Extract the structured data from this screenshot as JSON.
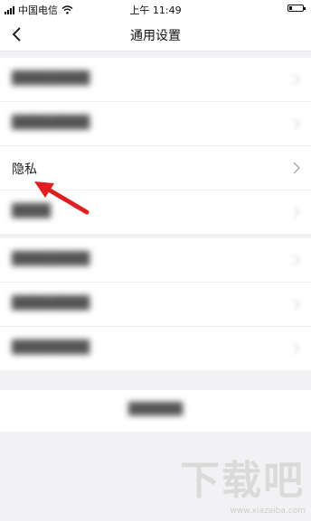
{
  "status_bar": {
    "carrier": "中国电信",
    "time": "上午 11:49",
    "wifi_icon": "wifi-icon",
    "battery_icon": "battery-icon"
  },
  "nav": {
    "back_icon": "chevron-left-icon",
    "title": "通用设置"
  },
  "settings_groups": [
    {
      "items": [
        {
          "label": "████████",
          "blurred": true
        },
        {
          "label": "████████",
          "blurred": true
        },
        {
          "label": "隐私",
          "blurred": false
        },
        {
          "label": "████",
          "blurred": true
        }
      ]
    },
    {
      "items": [
        {
          "label": "████████",
          "blurred": true
        },
        {
          "label": "████████",
          "blurred": true
        },
        {
          "label": "████████",
          "blurred": true
        }
      ]
    }
  ],
  "logout": {
    "label": "██████"
  },
  "annotation": {
    "icon": "red-arrow-icon",
    "color": "#e02020"
  },
  "watermark": {
    "text": "下载吧",
    "url": "www.xiazaiba.com"
  }
}
